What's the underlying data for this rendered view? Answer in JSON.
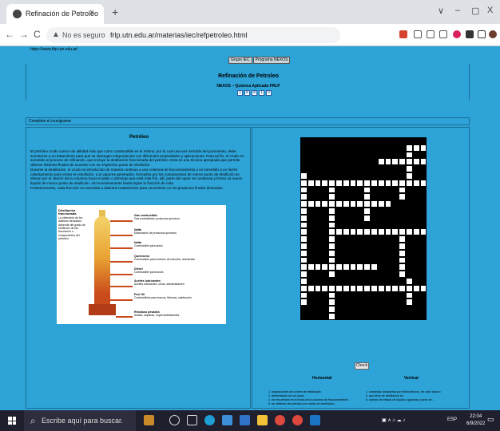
{
  "browser": {
    "tab_title": "Refinación de Petroleo",
    "tab_close": "×",
    "new_tab": "+",
    "win_down": "∨",
    "win_min": "–",
    "win_max": "▢",
    "win_close": "X",
    "back": "←",
    "forward": "→",
    "reload": "C",
    "security_label": "No es seguro",
    "url": "frlp.utn.edu.ar/materias/iec/refpetroleo.html",
    "warn_icon": "▲"
  },
  "site": {
    "top_url": "https://www.frlp.utn.edu.ar/",
    "nav": [
      "Grupo IEC",
      "Programa NEXOS"
    ],
    "title": "Refinación de Petroleo",
    "subtitle": "NEXOS – Química Aplicada FRLP",
    "num_buttons": [
      "1",
      "6",
      "8",
      "1",
      "0"
    ],
    "instruction": "Complete el crucigrama"
  },
  "reading": {
    "title": "Petróleo",
    "p1": "El petróleo crudo carece de utilidad más que como combustible en sí mismo, por lo cual una vez extraído del yacimiento, debe someterse a un tratamiento para que se obtengan subproductos con diferentes propiedades y aplicaciones. Para tal fin, el crudo es sometido al proceso de refinación, que incluye la destilación fraccionada del petróleo. Esta es una técnica apropiada que permite obtener distintos fluidos de acuerdo con su respectivo punto de ebullición.",
    "p2": "Durante la destilación, el crudo es introducido de manera continua a una columna de fraccionamiento y es sometido a un fuerte calentamiento para entrar en ebullición. Los vapores generados, formados por los componentes de menor punto de ebullición se elevan por el interior de la columna hacia el plato o domingo que está más frío, allí, parte del vapor se condensa y forma un nuevo líquido de menor punto de ebullición. Así sucesivamente hasta lograr la fracción de más.",
    "p3": "Posteriormente, cada fracción es sometida a distintos tratamientos para convertirse en los productos finales deseados."
  },
  "diagram": {
    "caption_title": "Destilación fraccionada",
    "caption": "La obtención de los distintos derivados depende del grado de ebullición de las fracciones o componentes del petróleo.",
    "fractions": [
      {
        "name": "Gas combustible",
        "use": "Gas embotellado, productos químicos"
      },
      {
        "name": "Nafta",
        "use": "Elaboración de productos químicos"
      },
      {
        "name": "Nafta",
        "use": "Combustible para autos"
      },
      {
        "name": "Queroseno",
        "use": "Combustible para motores de reacción, alumbrado"
      },
      {
        "name": "Diésel",
        "use": "Combustible para buses"
      },
      {
        "name": "Aceites lubricantes",
        "use": "Aceites lubricantes, ceras, abrillantadores"
      },
      {
        "name": "Fuel Oil",
        "use": "Combustibles para barcos, fábricas, calefacción"
      },
      {
        "name": "Residuos pesados",
        "use": "Asfalto, alquitrán, impermeabilizantes"
      }
    ]
  },
  "crossword": {
    "check_label": "Check",
    "horizontal_title": "Horizontal",
    "vertical_title": "Vertical",
    "horizontal_clues": [
      "1. separaciones de la torre de destilación:",
      "2. alimentación de los autos",
      "4. se encuentran en el fondo de la columna de fraccionamiento",
      "5. se obtienen del petróleo por medio de destilación..."
    ],
    "vertical_clues": [
      "1. sustancia compuesta por hidrocarburos, de color oscuro",
      "3. que tiene de destilación es",
      "5. cambio de estado de líquido a gaseoso; punto de..."
    ]
  },
  "taskbar": {
    "search_placeholder": "Escribe aquí para buscar.",
    "lang": "ESP",
    "time": "22:04",
    "date": "6/9/2022"
  }
}
